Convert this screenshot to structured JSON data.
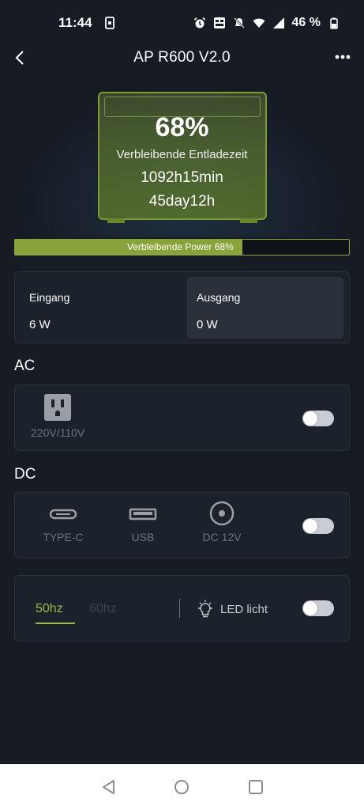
{
  "status_bar": {
    "time": "11:44",
    "battery_percent": "46 %"
  },
  "header": {
    "title": "AP R600 V2.0"
  },
  "hero": {
    "percent": "68%",
    "remaining_label": "Verbleibende Entladezeit",
    "remaining_time": "1092h15min",
    "remaining_days": "45day12h"
  },
  "power_bar": {
    "label": "Verbleibende Power 68%",
    "level": 0.68
  },
  "io": {
    "input": {
      "title": "Eingang",
      "value": "6 W"
    },
    "output": {
      "title": "Ausgang",
      "value": "0 W"
    }
  },
  "ac": {
    "title": "AC",
    "port_label": "220V/110V",
    "on": false
  },
  "dc": {
    "title": "DC",
    "ports": [
      {
        "icon": "usb-c-icon",
        "label": "TYPE-C"
      },
      {
        "icon": "usb-icon",
        "label": "USB"
      },
      {
        "icon": "dc-port-icon",
        "label": "DC 12V"
      }
    ],
    "on": false
  },
  "frequency": {
    "options": [
      "50hz",
      "60hz"
    ],
    "selected": "50hz",
    "led_label": "LED licht",
    "led_on": false
  },
  "colors": {
    "accent": "#9bb84a",
    "background": "#161b24",
    "card": "#1c222c"
  }
}
